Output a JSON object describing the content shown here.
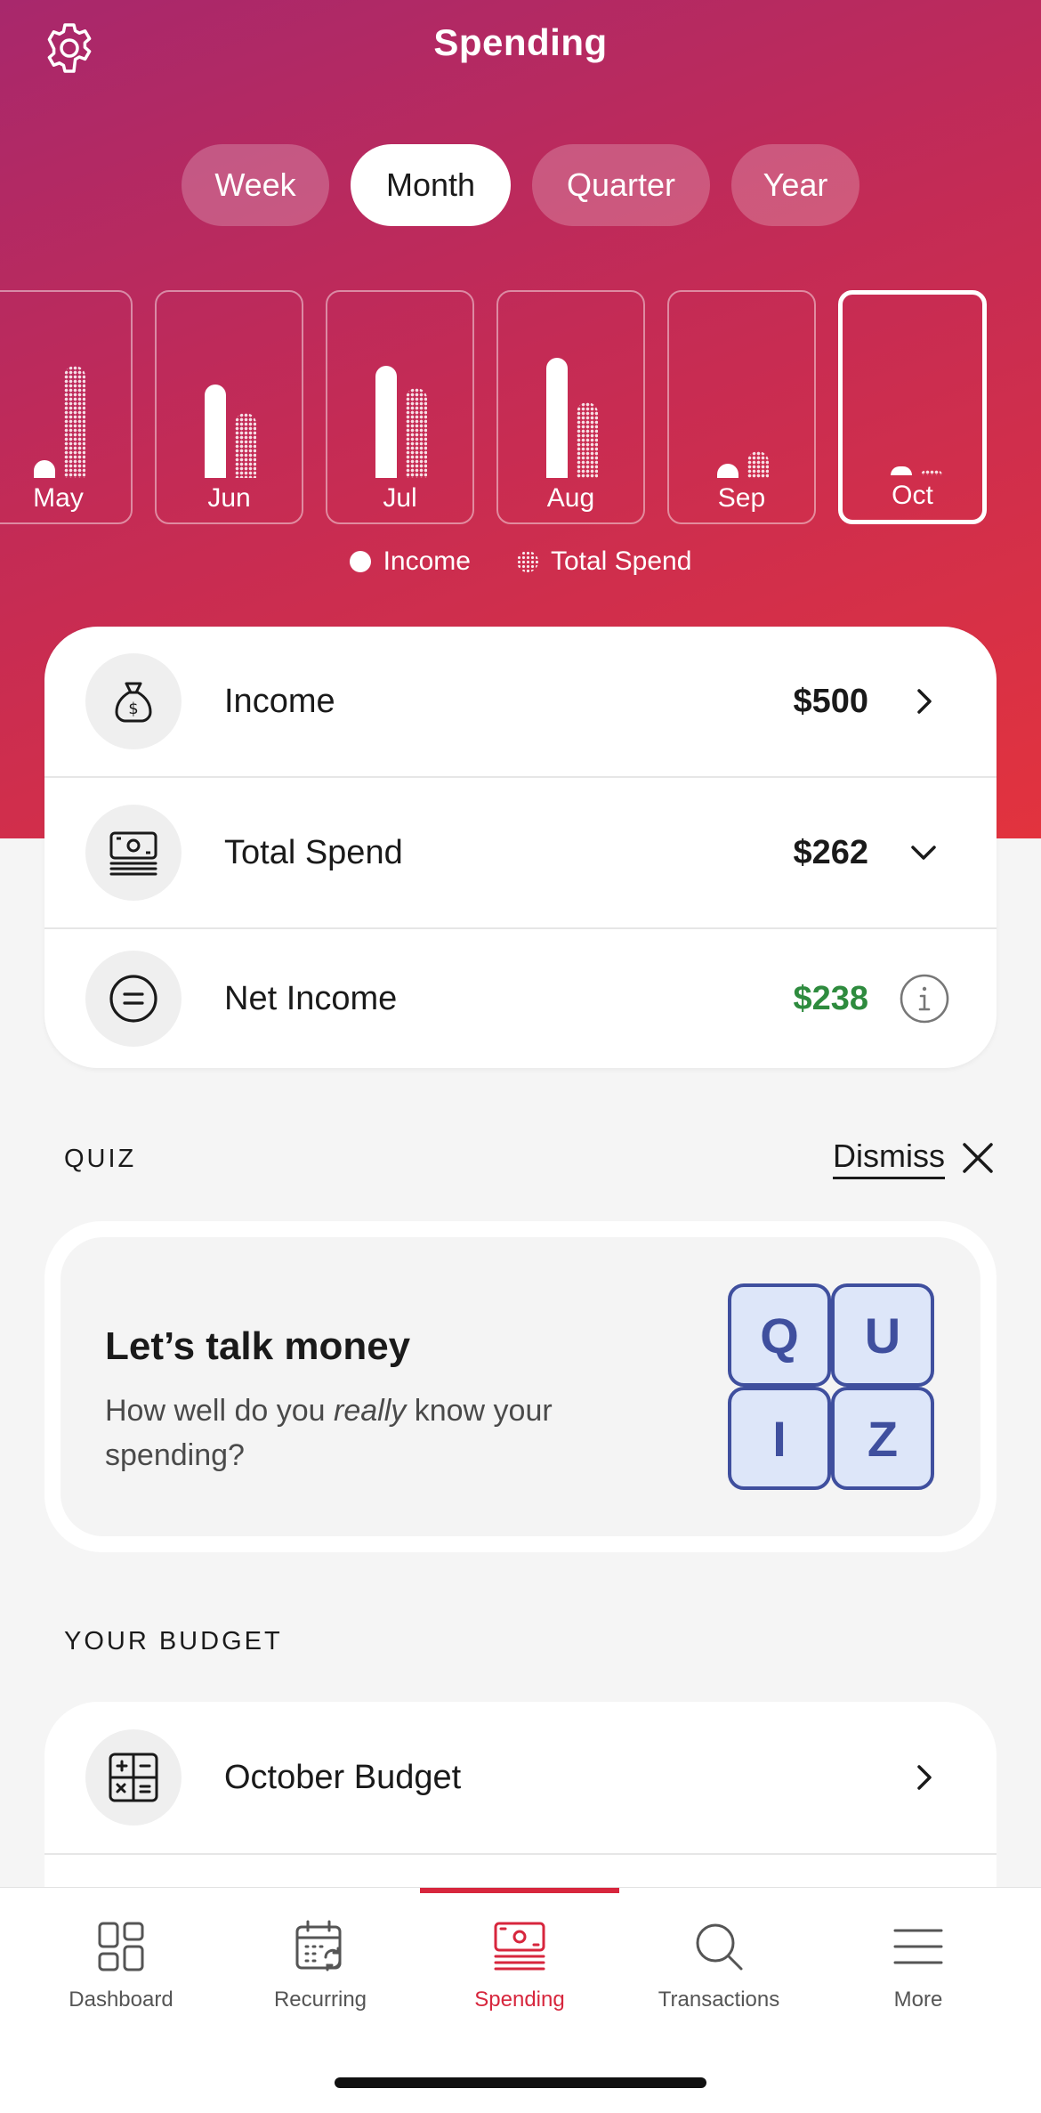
{
  "header": {
    "title": "Spending",
    "settings_icon": "gear-icon"
  },
  "period_tabs": [
    {
      "label": "Week",
      "active": false
    },
    {
      "label": "Month",
      "active": true
    },
    {
      "label": "Quarter",
      "active": false
    },
    {
      "label": "Year",
      "active": false
    }
  ],
  "chart_data": {
    "type": "bar",
    "categories": [
      "May",
      "Jun",
      "Jul",
      "Aug",
      "Sep",
      "Oct"
    ],
    "selected": "Oct",
    "series": [
      {
        "name": "Income",
        "values": [
          0.15,
          0.78,
          0.93,
          1.0,
          0.12,
          0.07
        ],
        "style": "solid"
      },
      {
        "name": "Total Spend",
        "values": [
          0.93,
          0.54,
          0.75,
          0.63,
          0.22,
          0.04
        ],
        "style": "dotted"
      }
    ]
  },
  "legend": {
    "income": "Income",
    "spend": "Total Spend"
  },
  "summary": {
    "income": {
      "label": "Income",
      "value": "$500",
      "icon": "money-bag-icon",
      "action_icon": "chevron-right-icon"
    },
    "spend": {
      "label": "Total Spend",
      "value": "$262",
      "icon": "cash-stack-icon",
      "action_icon": "chevron-down-icon"
    },
    "net": {
      "label": "Net Income",
      "value": "$238",
      "icon": "equals-icon",
      "action_icon": "info-icon",
      "value_color": "#2e8b3e"
    }
  },
  "quiz": {
    "section_label": "QUIZ",
    "dismiss_label": "Dismiss",
    "title": "Let’s talk money",
    "subtitle_before": "How well do you ",
    "subtitle_emphasis": "really",
    "subtitle_after": " know your spending?",
    "tiles": [
      "Q",
      "U",
      "I",
      "Z"
    ]
  },
  "budget": {
    "section_label": "YOUR BUDGET",
    "item_label": "October Budget",
    "icon": "calculator-icon"
  },
  "nav": [
    {
      "label": "Dashboard",
      "icon": "dashboard-icon",
      "active": false
    },
    {
      "label": "Recurring",
      "icon": "calendar-recurring-icon",
      "active": false
    },
    {
      "label": "Spending",
      "icon": "spending-icon",
      "active": true
    },
    {
      "label": "Transactions",
      "icon": "search-icon",
      "active": false
    },
    {
      "label": "More",
      "icon": "menu-icon",
      "active": false
    }
  ],
  "colors": {
    "accent": "#d7263d",
    "hero_start": "#a8286c",
    "hero_end": "#e2333e",
    "positive": "#2e8b3e",
    "quiz_tile": "#3f4f9e"
  }
}
